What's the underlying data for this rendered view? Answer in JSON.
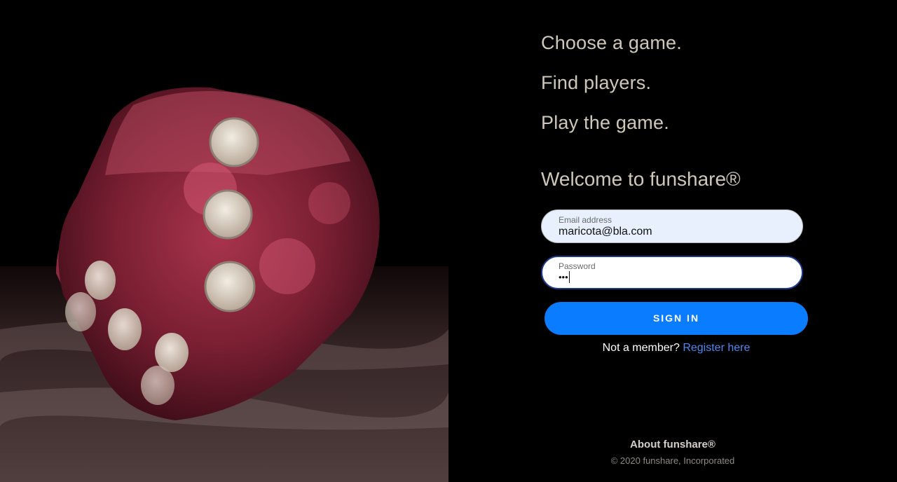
{
  "hero": {
    "image": "red-die-photo",
    "icon": "dice-icon"
  },
  "taglines": [
    "Choose a game.",
    "Find players.",
    "Play the game."
  ],
  "welcome": "Welcome to funshare®",
  "form": {
    "email": {
      "label": "Email address",
      "value": "maricota@bla.com"
    },
    "password": {
      "label": "Password",
      "value": "•••"
    },
    "signin_label": "SIGN IN",
    "not_member": "Not a member?",
    "register_link": "Register here"
  },
  "footer": {
    "about": "About funshare®",
    "copyright": "© 2020 funshare, Incorporated"
  },
  "colors": {
    "background": "#000000",
    "accent": "#0a7cff",
    "link": "#4a8af4",
    "tagline": "#cfc7b8",
    "die": "#c2405a"
  }
}
